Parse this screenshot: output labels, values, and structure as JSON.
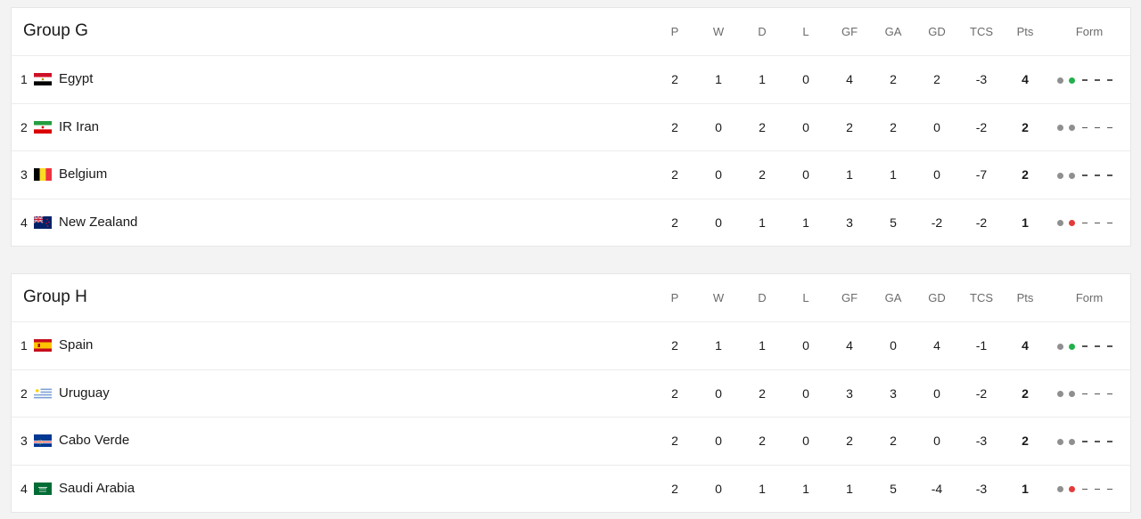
{
  "columns": [
    "P",
    "W",
    "D",
    "L",
    "GF",
    "GA",
    "GD",
    "TCS",
    "Pts",
    "Form"
  ],
  "colors": {
    "win": "#22b04b",
    "draw": "#8f8f8f",
    "loss": "#e23b3b"
  },
  "groups": [
    {
      "title": "Group G",
      "rows": [
        {
          "pos": "1",
          "team": "Egypt",
          "flag": "egypt-flag-icon",
          "p": "2",
          "w": "1",
          "d": "1",
          "l": "0",
          "gf": "4",
          "ga": "2",
          "gd": "2",
          "tcs": "-3",
          "pts": "4",
          "form": [
            "draw",
            "win"
          ]
        },
        {
          "pos": "2",
          "team": "IR Iran",
          "flag": "iran-flag-icon",
          "p": "2",
          "w": "0",
          "d": "2",
          "l": "0",
          "gf": "2",
          "ga": "2",
          "gd": "0",
          "tcs": "-2",
          "pts": "2",
          "form": [
            "draw",
            "draw"
          ]
        },
        {
          "pos": "3",
          "team": "Belgium",
          "flag": "belgium-flag-icon",
          "p": "2",
          "w": "0",
          "d": "2",
          "l": "0",
          "gf": "1",
          "ga": "1",
          "gd": "0",
          "tcs": "-7",
          "pts": "2",
          "form": [
            "draw",
            "draw"
          ]
        },
        {
          "pos": "4",
          "team": "New Zealand",
          "flag": "new-zealand-flag-icon",
          "p": "2",
          "w": "0",
          "d": "1",
          "l": "1",
          "gf": "3",
          "ga": "5",
          "gd": "-2",
          "tcs": "-2",
          "pts": "1",
          "form": [
            "draw",
            "loss"
          ]
        }
      ]
    },
    {
      "title": "Group H",
      "rows": [
        {
          "pos": "1",
          "team": "Spain",
          "flag": "spain-flag-icon",
          "p": "2",
          "w": "1",
          "d": "1",
          "l": "0",
          "gf": "4",
          "ga": "0",
          "gd": "4",
          "tcs": "-1",
          "pts": "4",
          "form": [
            "draw",
            "win"
          ]
        },
        {
          "pos": "2",
          "team": "Uruguay",
          "flag": "uruguay-flag-icon",
          "p": "2",
          "w": "0",
          "d": "2",
          "l": "0",
          "gf": "3",
          "ga": "3",
          "gd": "0",
          "tcs": "-2",
          "pts": "2",
          "form": [
            "draw",
            "draw"
          ]
        },
        {
          "pos": "3",
          "team": "Cabo Verde",
          "flag": "cabo-verde-flag-icon",
          "p": "2",
          "w": "0",
          "d": "2",
          "l": "0",
          "gf": "2",
          "ga": "2",
          "gd": "0",
          "tcs": "-3",
          "pts": "2",
          "form": [
            "draw",
            "draw"
          ]
        },
        {
          "pos": "4",
          "team": "Saudi Arabia",
          "flag": "saudi-arabia-flag-icon",
          "p": "2",
          "w": "0",
          "d": "1",
          "l": "1",
          "gf": "1",
          "ga": "5",
          "gd": "-4",
          "tcs": "-3",
          "pts": "1",
          "form": [
            "draw",
            "loss"
          ]
        }
      ]
    }
  ]
}
